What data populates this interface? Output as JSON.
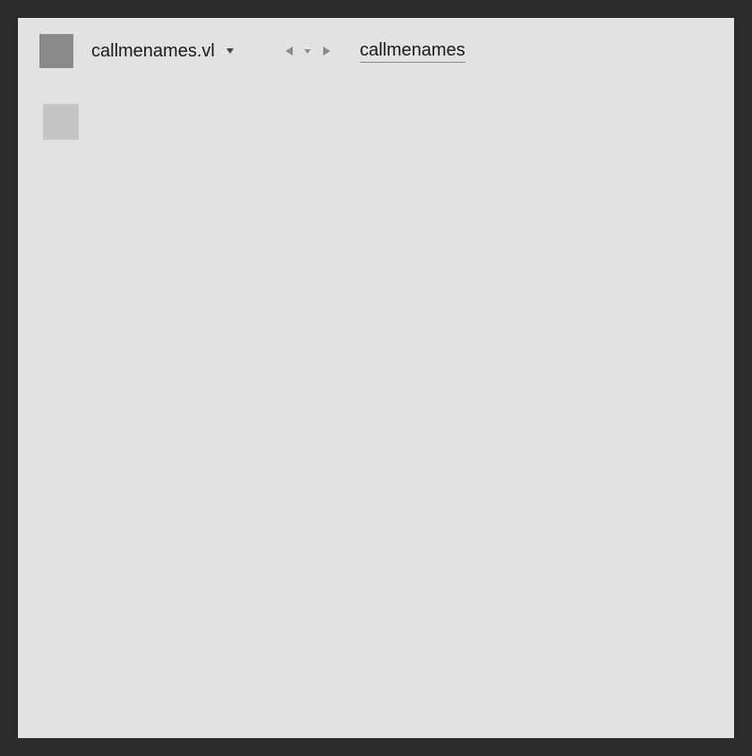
{
  "header": {
    "document_title": "callmenames.vl",
    "patch_name": "callmenames"
  }
}
